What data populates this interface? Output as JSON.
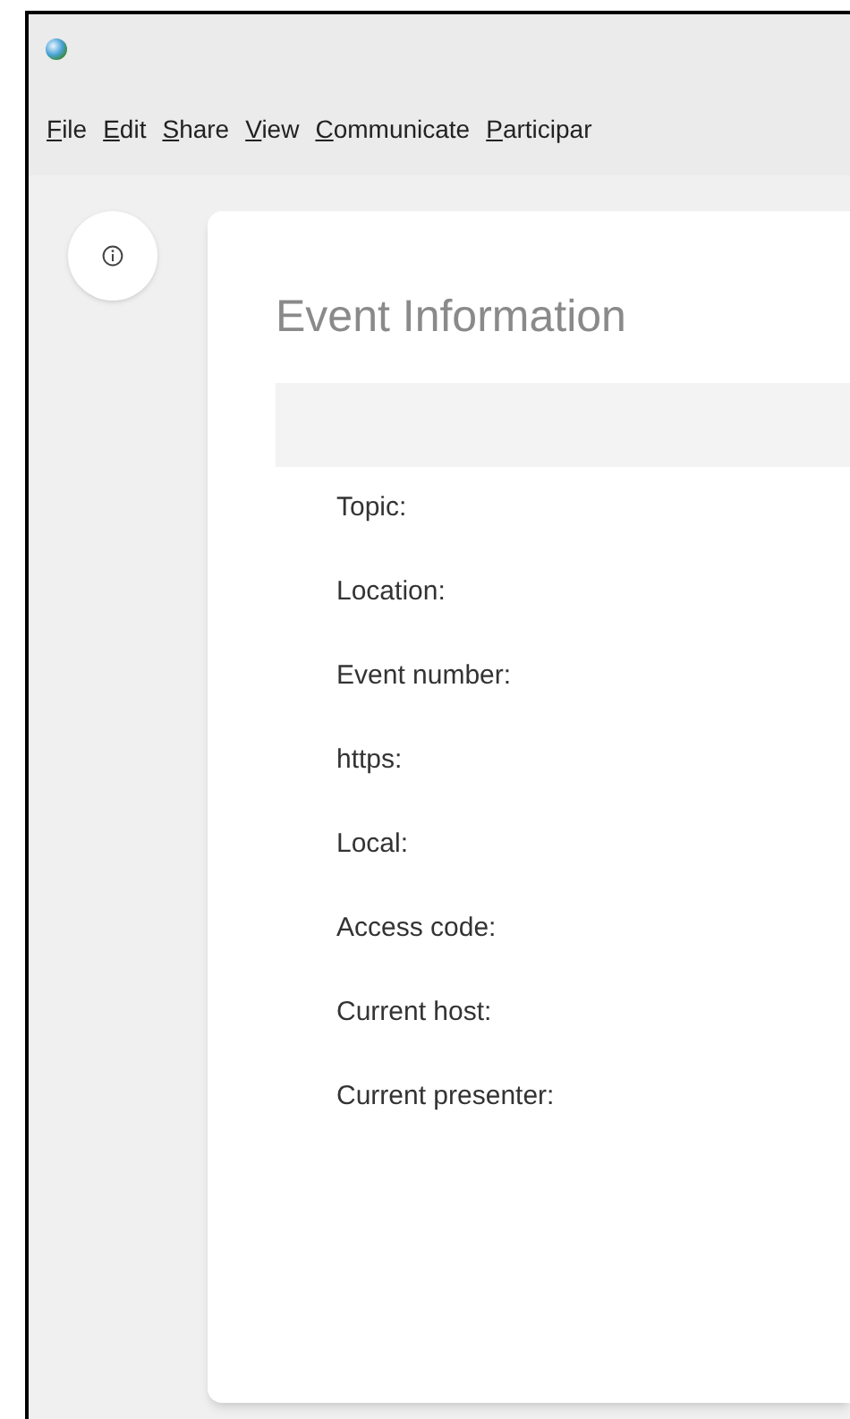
{
  "menu_bar": [
    {
      "label": "File"
    },
    {
      "label": "Edit"
    },
    {
      "label": "Share"
    },
    {
      "label": "View"
    },
    {
      "label": "Communicate"
    },
    {
      "label": "Participar"
    }
  ],
  "event_information": {
    "title": "Event Information",
    "fields": [
      {
        "label": "Topic:"
      },
      {
        "label": "Location:"
      },
      {
        "label": "Event number:"
      },
      {
        "label": "https:"
      },
      {
        "label": "Local:"
      },
      {
        "label": "Access code:"
      },
      {
        "label": "Current host:"
      },
      {
        "label": "Current presenter:"
      }
    ]
  }
}
